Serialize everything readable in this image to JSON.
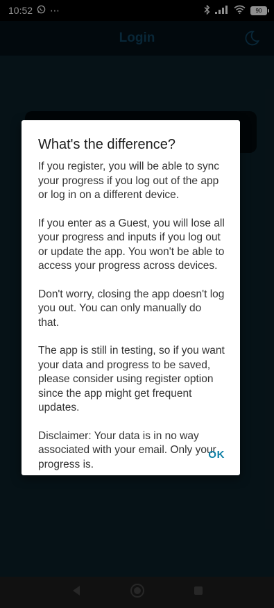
{
  "status_bar": {
    "time": "10:52",
    "overflow": "⋯",
    "battery": "90",
    "icons": [
      "whatsapp-icon",
      "bluetooth-icon",
      "signal-icon",
      "wifi-icon",
      "battery-icon"
    ]
  },
  "app_bar": {
    "title": "Login",
    "icon": "moon-icon",
    "title_color": "#0e3d57"
  },
  "dialog": {
    "title": "What's the difference?",
    "paragraphs": [
      "If you register, you will be able to sync your progress if you log out of the app or log in on a different device.",
      "If you enter as a Guest, you will lose all your progress and inputs if you log out or update the app. You won't be able to access your progress across devices.",
      "Don't worry, closing the app doesn't log you out. You can only manually do that.",
      "The app is still in testing, so if you want your data and progress to be saved, please consider using register option since the app might get frequent updates.",
      "Disclaimer: Your data is in no way associated with your email. Only your progress is."
    ],
    "ok_label": "OK",
    "accent_color": "#0d7fa6"
  },
  "nav_bar": {
    "icons": [
      "back-icon",
      "home-icon",
      "recents-icon"
    ]
  }
}
